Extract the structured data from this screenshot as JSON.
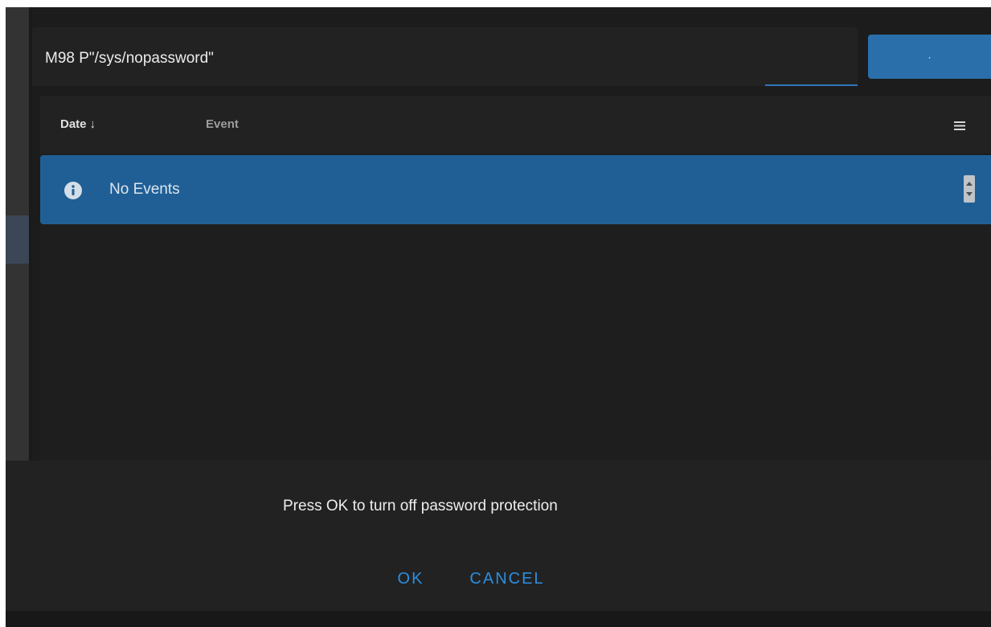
{
  "command_bar": {
    "input_value": "M98 P\"/sys/nopassword\"",
    "send_button_label": "·"
  },
  "events_table": {
    "columns": [
      {
        "label": "Date",
        "sort_indicator": "↓"
      },
      {
        "label": "Event"
      }
    ],
    "columns_menu_icon": "menu-icon",
    "empty_message": "No Events",
    "empty_icon": "info-icon"
  },
  "dialog": {
    "message": "Press OK to turn off password protection",
    "ok_label": "OK",
    "cancel_label": "CANCEL"
  },
  "colors": {
    "accent": "#2a6faa",
    "info_banner": "#205f96",
    "dialog_button_text": "#2c8ee0",
    "background": "#1c1c1c"
  }
}
